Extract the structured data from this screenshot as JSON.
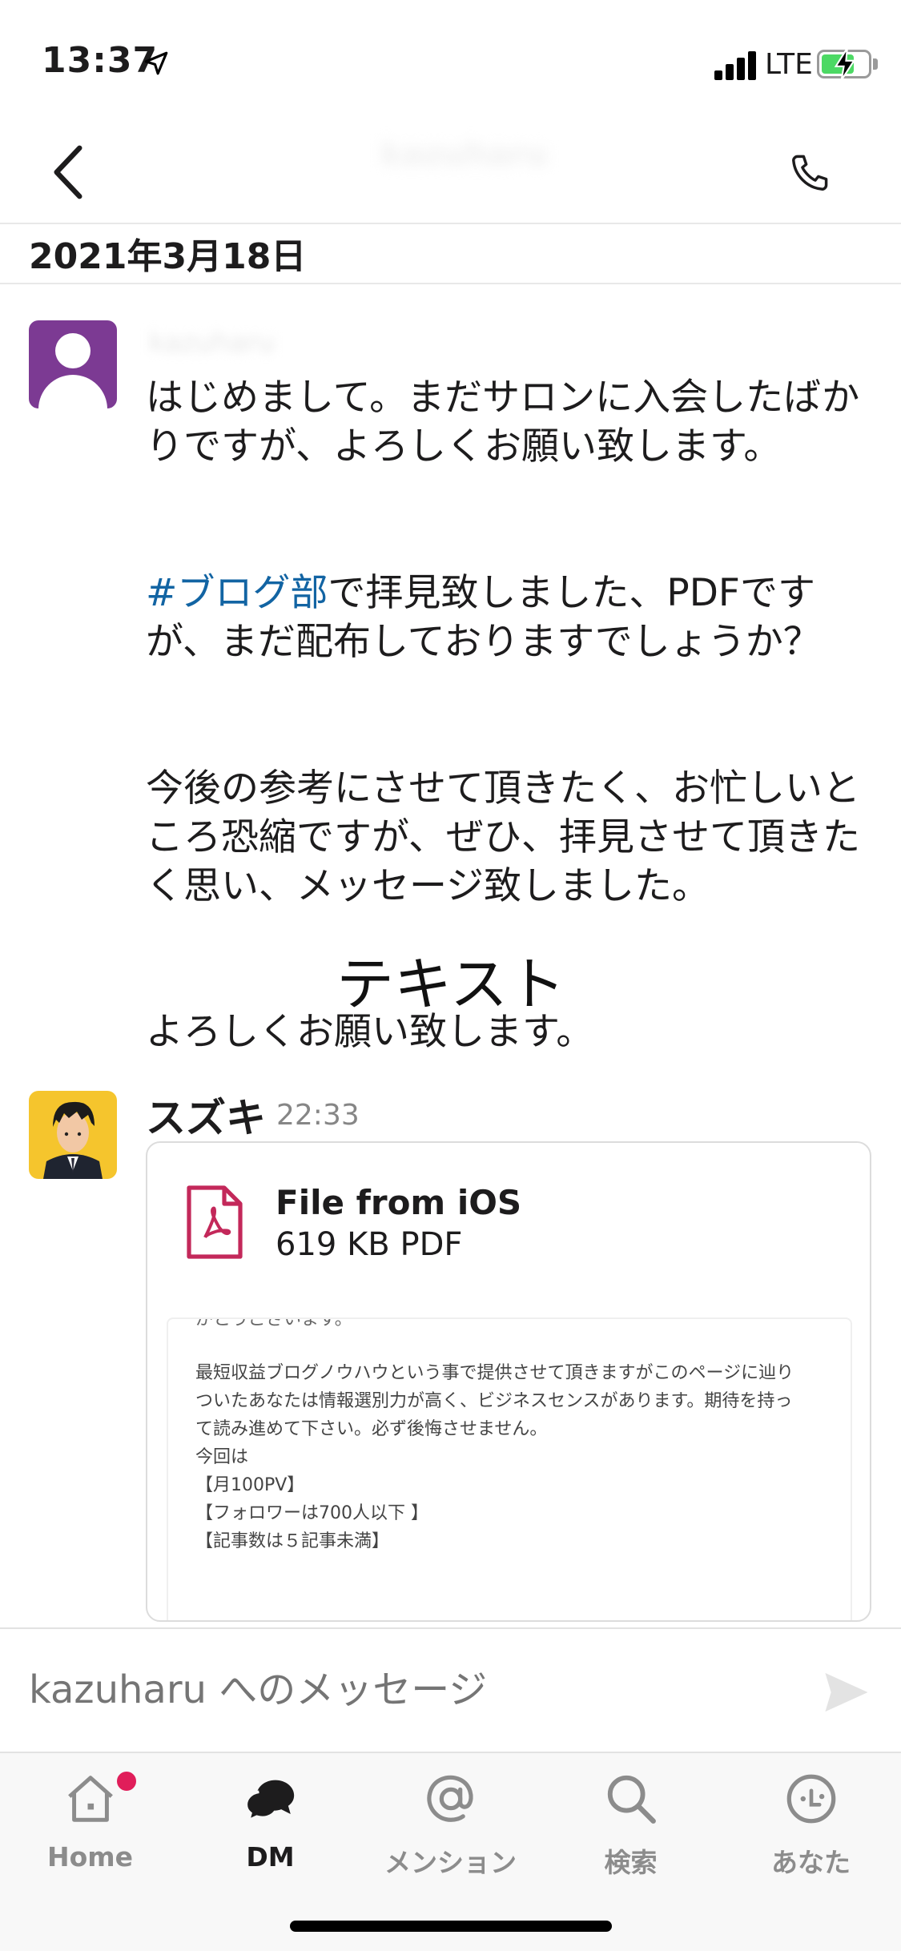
{
  "status_bar": {
    "time": "13:37",
    "network": "LTE"
  },
  "header": {
    "title": "kazuharu"
  },
  "date_divider": {
    "label": "2021年3月18日"
  },
  "messages": [
    {
      "sender": "kazuharu",
      "paragraphs": [
        "はじめまして。まだサロンに入会したばかりですが、よろしくお願い致します。",
        "#ブログ部",
        "で拝見致しました、PDFですが、まだ配布しておりますでしょうか？",
        "今後の参考にさせて頂きたく、お忙しいところ恐縮ですが、ぜひ、拝見させて頂きたく思い、メッセージ致しました。",
        "よろしくお願い致します。"
      ]
    },
    {
      "sender": "スズキ",
      "time": "22:33",
      "file": {
        "name": "File from iOS",
        "meta": "619 KB PDF",
        "preview_top": "がとうございます。",
        "preview_lines": [
          "最短収益ブログノウハウという事で提供させて頂きますがこのページに辿り",
          "ついたあなたは情報選別力が高く、ビジネスセンスがあります。期待を持っ",
          "て読み進めて下さい。必ず後悔させません。",
          "",
          "今回は",
          "",
          "【月100PV】",
          "【フォロワーは700人以下 】",
          "【記事数は５記事未満】"
        ]
      }
    }
  ],
  "overlay_text": "テキスト",
  "composer": {
    "placeholder": "kazuharu へのメッセージ"
  },
  "tabs": [
    {
      "label": "Home",
      "icon": "home-icon",
      "badge": true
    },
    {
      "label": "DM",
      "icon": "dm-icon",
      "active": true
    },
    {
      "label": "メンション",
      "icon": "mention-icon"
    },
    {
      "label": "検索",
      "icon": "search-icon"
    },
    {
      "label": "あなた",
      "icon": "you-icon"
    }
  ],
  "colors": {
    "link": "#1264a3",
    "badge": "#e01e5a",
    "avatar_purple": "#7c3a93",
    "pdf_red": "#c3285a"
  }
}
